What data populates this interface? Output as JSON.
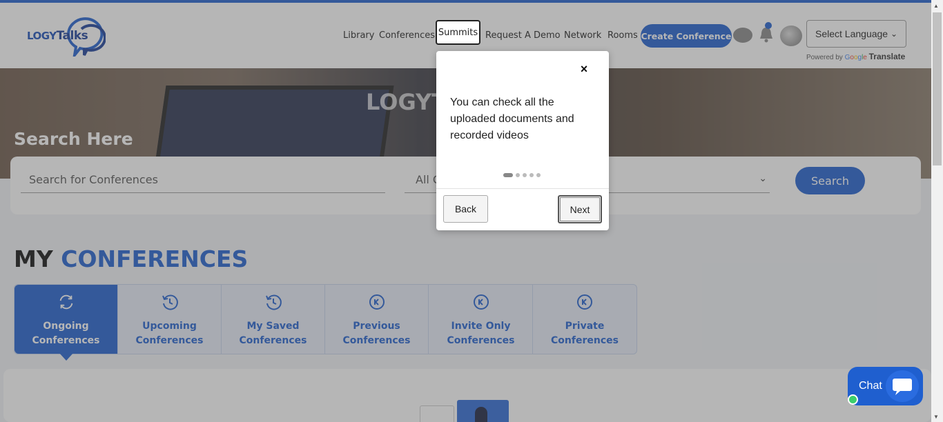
{
  "header": {
    "logo_left": "LOGY",
    "logo_right": "Talks",
    "nav": [
      "Library",
      "Conferences",
      "Summits",
      "Request A Demo",
      "Network",
      "Rooms"
    ],
    "create_button": "Create Conference",
    "language_select": "Select Language",
    "powered_by": "Powered by",
    "google_letters": [
      "G",
      "o",
      "o",
      "g",
      "l",
      "e"
    ],
    "translate": "Translate"
  },
  "hero": {
    "logo_watermark": "LOGYT",
    "title": "Search Here"
  },
  "search": {
    "placeholder": "Search for Conferences",
    "category_value": "All C",
    "button": "Search"
  },
  "section": {
    "title_part1": "MY",
    "title_part2": "CONFERENCES"
  },
  "tabs": [
    {
      "label_line1": "Ongoing",
      "label_line2": "Conferences"
    },
    {
      "label_line1": "Upcoming",
      "label_line2": "Conferences"
    },
    {
      "label_line1": "My Saved",
      "label_line2": "Conferences"
    },
    {
      "label_line1": "Previous",
      "label_line2": "Conferences"
    },
    {
      "label_line1": "Invite Only",
      "label_line2": "Conferences"
    },
    {
      "label_line1": "Private",
      "label_line2": "Conferences"
    }
  ],
  "tour": {
    "close": "×",
    "text": "You can check all the uploaded documents and recorded videos",
    "back": "Back",
    "next": "Next"
  },
  "chat": {
    "label": "Chat"
  },
  "colors": {
    "brand_blue": "#1f5fcf",
    "online_green": "#3ccf6c"
  }
}
